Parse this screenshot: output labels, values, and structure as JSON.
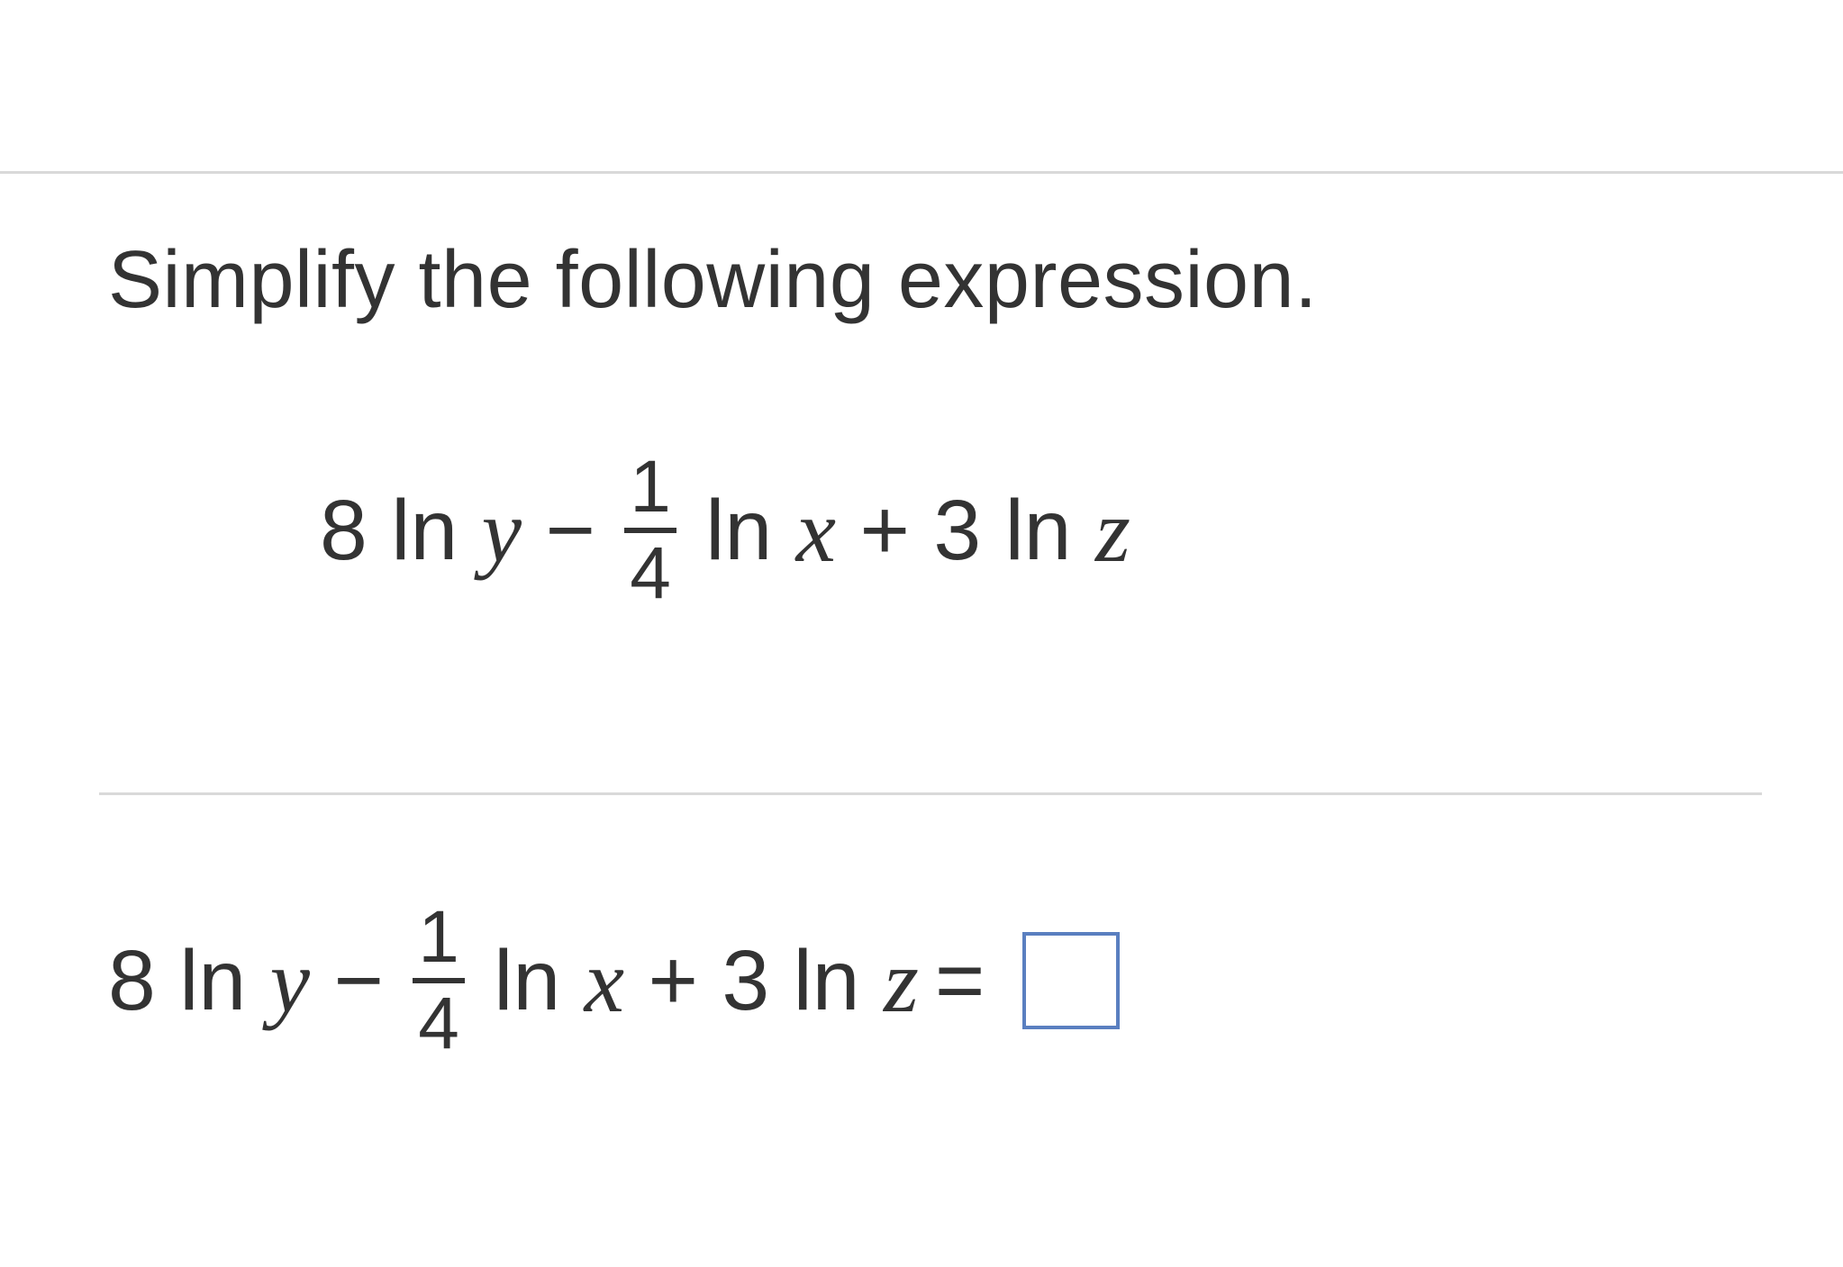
{
  "prompt": "Simplify the following expression.",
  "expression": {
    "coef_y": "8",
    "ln": "ln",
    "var_y": "y",
    "minus": " − ",
    "frac_num": "1",
    "frac_den": "4",
    "var_x": "x",
    "plus": " + ",
    "coef_z": "3",
    "var_z": "z"
  },
  "equals": "=",
  "answer_value": ""
}
